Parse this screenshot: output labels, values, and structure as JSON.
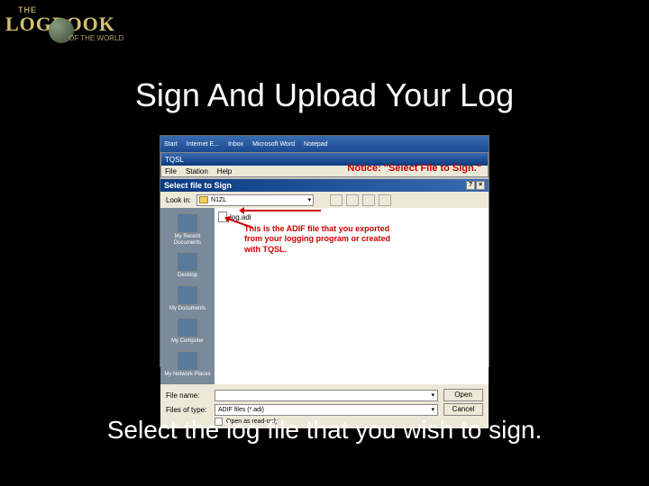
{
  "logo": {
    "the": "THE",
    "main": "LOGBOOK",
    "tag": "OF THE WORLD"
  },
  "slide": {
    "title": "Sign And Upload Your Log",
    "caption": "Select the log file that you wish to sign."
  },
  "taskbar": {
    "items": [
      "Start",
      "Internet E...",
      "Inbox",
      "Microsoft Word",
      "Notepad"
    ]
  },
  "tqsl": {
    "title": "TQSL",
    "menu": [
      "File",
      "Station",
      "Help"
    ]
  },
  "notice": "Notice: \"Select File to Sign.\"",
  "dialog": {
    "title": "Select file to Sign",
    "lookin_label": "Look in:",
    "lookin_value": "N1ZL",
    "places": [
      "My Recent Documents",
      "Desktop",
      "My Documents",
      "My Computer",
      "My Network Places"
    ],
    "file": "log.adi",
    "annotation": "This is the ADIF file that you exported from your logging program or created with TQSL.",
    "filename_label": "File name:",
    "filename_value": "",
    "filetype_label": "Files of type:",
    "filetype_value": "ADIF files (*.adi)",
    "open": "Open",
    "cancel": "Cancel",
    "readonly": "Open as read-only"
  }
}
